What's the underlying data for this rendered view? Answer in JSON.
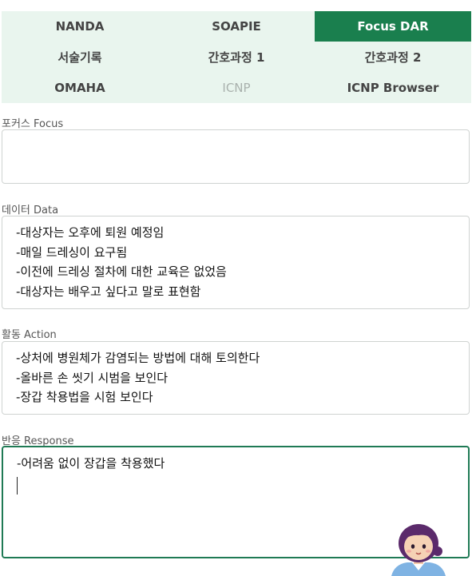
{
  "tabs": [
    {
      "label": "NANDA",
      "state": "normal"
    },
    {
      "label": "SOAPIE",
      "state": "normal"
    },
    {
      "label": "Focus DAR",
      "state": "active"
    },
    {
      "label": "서술기록",
      "state": "normal"
    },
    {
      "label": "간호과정 1",
      "state": "normal"
    },
    {
      "label": "간호과정 2",
      "state": "normal"
    },
    {
      "label": "OMAHA",
      "state": "normal"
    },
    {
      "label": "ICNP",
      "state": "disabled"
    },
    {
      "label": "ICNP Browser",
      "state": "normal"
    }
  ],
  "focus": {
    "label": "포커스 Focus",
    "lines": []
  },
  "data": {
    "label": "데이터 Data",
    "lines": [
      "-대상자는 오후에 퇴원 예정임",
      "-매일 드레싱이 요구됨",
      "-이전에 드레싱 절차에 대한 교육은 없었음",
      "-대상자는 배우고 싶다고 말로 표현함"
    ]
  },
  "action": {
    "label": "활동 Action",
    "lines": [
      "-상처에 병원체가 감염되는 방법에 대해 토의한다",
      "-올바른 손 씻기 시범을 보인다",
      "-장갑 착용법을 시험 보인다"
    ]
  },
  "response": {
    "label": "반응 Response",
    "lines": [
      "-어려움 없이 장갑을 착용했다"
    ]
  },
  "colors": {
    "accent": "#1a7f4e",
    "tab_bg": "#e9f5ee"
  },
  "icons": {
    "assistant": "nurse-avatar-icon"
  }
}
